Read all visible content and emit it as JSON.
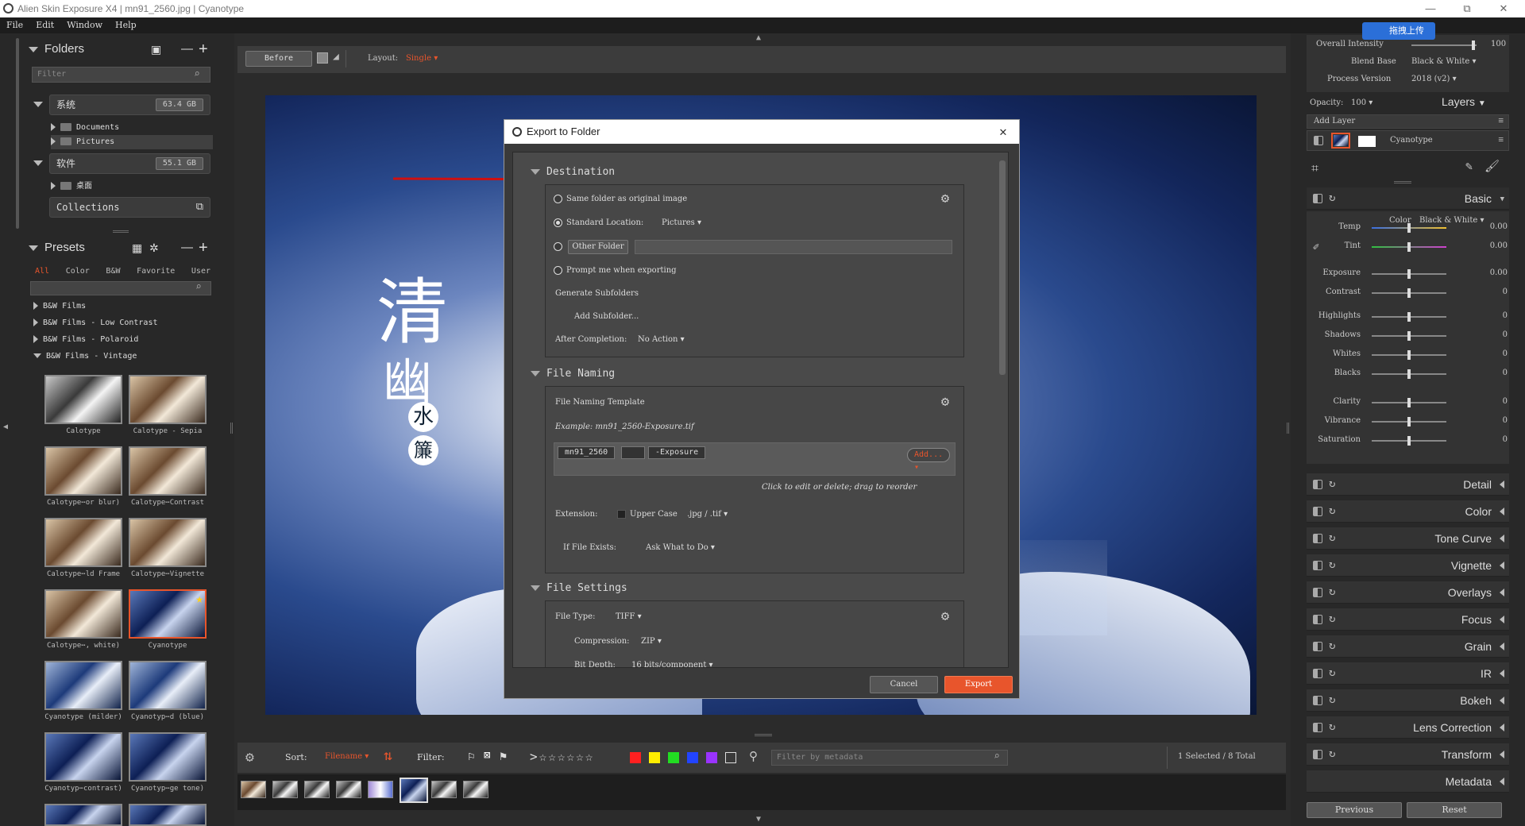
{
  "window": {
    "title": "Alien Skin Exposure X4 | mn91_2560.jpg | Cyanotype",
    "minimize": "—",
    "maximize": "⧉",
    "close": "✕"
  },
  "menu": [
    "File",
    "Edit",
    "Window",
    "Help"
  ],
  "folders": {
    "title": "Folders",
    "filter_placeholder": "Filter",
    "drives": [
      {
        "label": "系统",
        "size": "63.4 GB"
      },
      {
        "label": "软件",
        "size": "55.1 GB"
      }
    ],
    "subfolders": [
      "Documents",
      "Pictures",
      "桌面"
    ],
    "collections": "Collections"
  },
  "presets": {
    "title": "Presets",
    "tabs": [
      "All",
      "Color",
      "B&W",
      "Favorite",
      "User"
    ],
    "groups": [
      "B&W Films",
      "B&W Films - Low Contrast",
      "B&W Films - Polaroid",
      "B&W Films - Vintage"
    ],
    "thumbs": [
      "Calotype",
      "Calotype - Sepia",
      "Calotype⋯or blur)",
      "Calotype⋯Contrast",
      "Calotype⋯ld Frame",
      "Calotype⋯Vignette",
      "Calotype⋯, white)",
      "Cyanotype",
      "Cyanotype (milder)",
      "Cyanotyp⋯d (blue)",
      "Cyanotyp⋯contrast)",
      "Cyanotyp⋯ge tone)"
    ]
  },
  "toolbar": {
    "before": "Before",
    "layout_label": "Layout:",
    "layout_value": "Single"
  },
  "photo": {
    "char1": "清",
    "char2": "幽",
    "char3": "水",
    "char4": "簾"
  },
  "bottombar": {
    "sort_label": "Sort:",
    "sort_value": "Filename",
    "filter_label": "Filter:",
    "metadata_placeholder": "Filter by metadata",
    "status": "1 Selected / 8 Total",
    "colors": [
      "#ff2020",
      "#ffee00",
      "#22dd22",
      "#2244ff",
      "#9a33ff"
    ]
  },
  "dialog": {
    "title": "Export to Folder",
    "destination": {
      "heading": "Destination",
      "same_folder": "Same folder as original image",
      "standard_label": "Standard Location:",
      "standard_value": "Pictures",
      "other_folder": "Other Folder",
      "prompt": "Prompt me when exporting",
      "generate": "Generate Subfolders",
      "add_subfolder": "Add Subfolder...",
      "after_label": "After Completion:",
      "after_value": "No Action"
    },
    "naming": {
      "heading": "File Naming",
      "template": "File Naming Template",
      "example": "Example: mn91_2560-Exposure.tif",
      "tokens": [
        "mn91_2560",
        "",
        "-Exposure"
      ],
      "add": "Add...",
      "hint": "Click to edit or delete; drag to reorder",
      "extension_label": "Extension:",
      "upper_case": "Upper Case",
      "ext_value": ".jpg / .tif",
      "exists_label": "If File Exists:",
      "exists_value": "Ask What to Do"
    },
    "settings": {
      "heading": "File Settings",
      "type_label": "File Type:",
      "type_value": "TIFF",
      "compression_label": "Compression:",
      "compression_value": "ZIP",
      "depth_label": "Bit Depth:",
      "depth_value": "16 bits/component"
    },
    "cancel": "Cancel",
    "export": "Export"
  },
  "right": {
    "overall_label": "Overall Intensity",
    "overall_value": "100",
    "overall_level": 0.95,
    "blend_label": "Blend Base",
    "blend_value": "Black & White",
    "process_label": "Process Version",
    "process_value": "2018 (v2)",
    "opacity_label": "Opacity:",
    "opacity_value": "100",
    "layers": "Layers",
    "add_layer": "Add Layer",
    "layer_name": "Cyanotype",
    "basic": "Basic",
    "color_label": "Color",
    "color_value": "Black & White",
    "sliders": [
      {
        "label": "Temp",
        "value": "0.00",
        "level": 0.5
      },
      {
        "label": "Tint",
        "value": "0.00",
        "level": 0.5
      },
      {
        "label": "Exposure",
        "value": "0.00",
        "level": 0.5
      },
      {
        "label": "Contrast",
        "value": "0",
        "level": 0.5
      },
      {
        "label": "Highlights",
        "value": "0",
        "level": 0.5
      },
      {
        "label": "Shadows",
        "value": "0",
        "level": 0.5
      },
      {
        "label": "Whites",
        "value": "0",
        "level": 0.5
      },
      {
        "label": "Blacks",
        "value": "0",
        "level": 0.5
      },
      {
        "label": "Clarity",
        "value": "0",
        "level": 0.5
      },
      {
        "label": "Vibrance",
        "value": "0",
        "level": 0.5
      },
      {
        "label": "Saturation",
        "value": "0",
        "level": 0.5
      }
    ],
    "adjustments": [
      "Detail",
      "Color",
      "Tone Curve",
      "Vignette",
      "Overlays",
      "Focus",
      "Grain",
      "IR",
      "Bokeh",
      "Lens Correction",
      "Transform",
      "Metadata"
    ],
    "previous": "Previous",
    "reset": "Reset",
    "upload_badge": "拖拽上传"
  }
}
